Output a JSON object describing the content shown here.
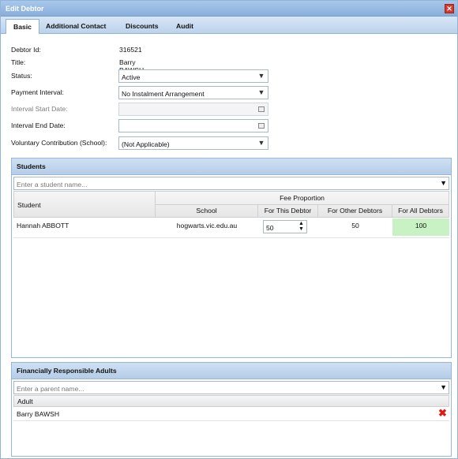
{
  "window": {
    "title": "Edit Debtor"
  },
  "tabs": [
    "Basic",
    "Additional Contact",
    "Discounts",
    "Audit"
  ],
  "form": {
    "debtor_id_label": "Debtor Id:",
    "debtor_id": "316521",
    "title_label": "Title:",
    "title": "Barry BAWSH",
    "status_label": "Status:",
    "status": "Active",
    "payment_interval_label": "Payment Interval:",
    "payment_interval": "No Instalment Arrangement",
    "interval_start_label": "Interval Start Date:",
    "interval_end_label": "Interval End Date:",
    "voluntary_label": "Voluntary Contribution (School):",
    "voluntary": "(Not Applicable)"
  },
  "students": {
    "heading": "Students",
    "search_placeholder": "Enter a student name...",
    "col_student": "Student",
    "col_fee_proportion": "Fee Proportion",
    "col_school": "School",
    "col_this": "For This Debtor",
    "col_other": "For Other Debtors",
    "col_all": "For All Debtors",
    "rows": [
      {
        "student": "Hannah ABBOTT",
        "school": "hogwarts.vic.edu.au",
        "this": "50",
        "other": "50",
        "all": "100"
      }
    ]
  },
  "adults": {
    "heading": "Financially Responsible Adults",
    "search_placeholder": "Enter a parent name...",
    "col_adult": "Adult",
    "rows": [
      {
        "adult": "Barry BAWSH"
      }
    ]
  }
}
